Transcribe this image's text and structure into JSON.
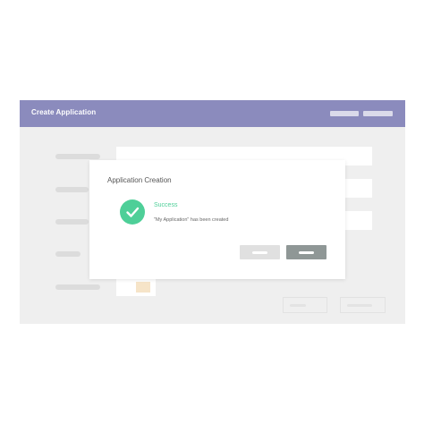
{
  "window": {
    "title": "Create Application",
    "header_buttons": [
      "header-button-1",
      "header-button-2"
    ]
  },
  "sidebar": {
    "items": [
      "nav-item-1",
      "nav-item-2",
      "nav-item-3",
      "nav-item-4",
      "nav-item-5"
    ]
  },
  "dialog": {
    "title": "Application Creation",
    "status": "Success",
    "message": "\"My Application\" has been created",
    "buttons": [
      "cancel",
      "confirm"
    ]
  },
  "colors": {
    "header": "#8b8bbd",
    "success": "#4ecf98",
    "primary_button": "#8f9796",
    "secondary_button": "#e0e0e0"
  },
  "icons": {
    "success": "checkmark-circle-icon"
  }
}
